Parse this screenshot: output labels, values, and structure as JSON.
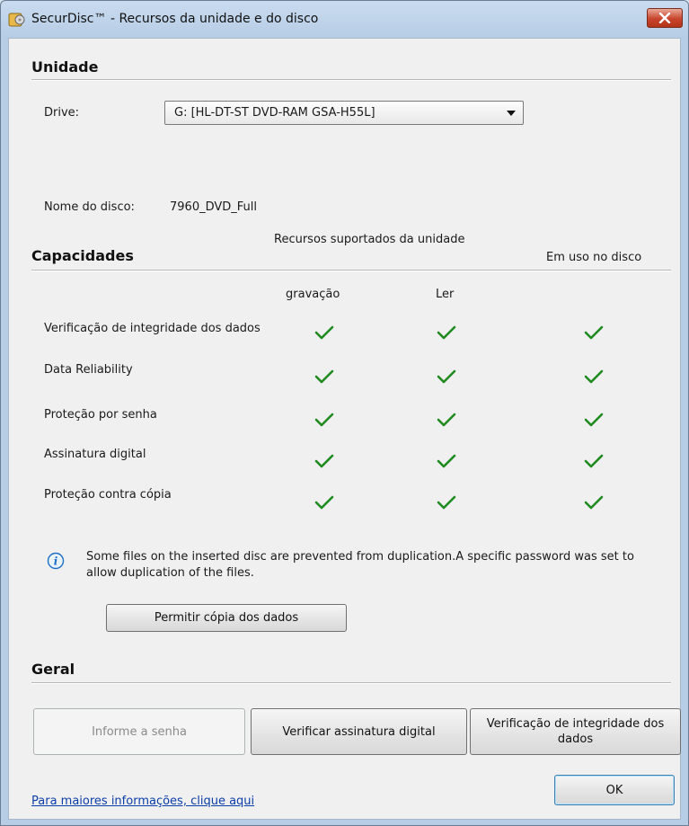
{
  "window": {
    "title": "SecurDisc™ - Recursos da unidade e do disco"
  },
  "unidade": {
    "section_title": "Unidade",
    "drive_label": "Drive:",
    "drive_value": "G: [HL-DT-ST DVD-RAM GSA-H55L]",
    "disc_name_label": "Nome do disco:",
    "disc_name_value": "7960_DVD_Full"
  },
  "capacidades": {
    "section_title": "Capacidades",
    "supported_header": "Recursos suportados da unidade",
    "in_use_header": "Em uso no disco",
    "col_write": "gravação",
    "col_read": "Ler",
    "rows": [
      {
        "label": "Verificação de integridade dos dados",
        "write": true,
        "read": true,
        "in_use": true
      },
      {
        "label": "Data Reliability",
        "write": true,
        "read": true,
        "in_use": true
      },
      {
        "label": "Proteção por senha",
        "write": true,
        "read": true,
        "in_use": true
      },
      {
        "label": "Assinatura digital",
        "write": true,
        "read": true,
        "in_use": true
      },
      {
        "label": "Proteção contra cópia",
        "write": true,
        "read": true,
        "in_use": true
      }
    ]
  },
  "info": {
    "icon": "info-icon",
    "text": "Some files on the inserted disc are prevented from duplication.A specific password was set to allow duplication of the files.",
    "allow_copy_button": "Permitir cópia dos dados"
  },
  "geral": {
    "section_title": "Geral",
    "password_button": "Informe a senha",
    "verify_signature_button": "Verificar assinatura digital",
    "integrity_button": "Verificação de integridade dos dados"
  },
  "footer": {
    "more_info_link": "Para maiores informações, clique aqui",
    "ok_button": "OK"
  },
  "colors": {
    "check": "#1f8a1f",
    "link": "#0b3ea8",
    "info": "#1c6fc4"
  }
}
